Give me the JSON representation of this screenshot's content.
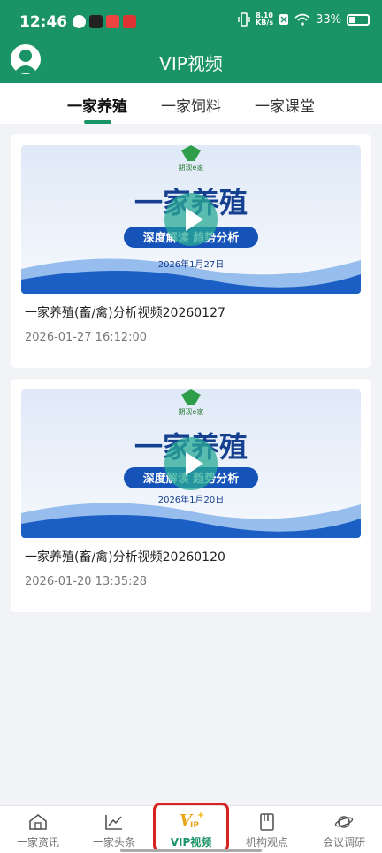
{
  "status_bar": {
    "time": "12:46",
    "speed_top": "8.10",
    "speed_unit": "KB/s",
    "battery": "33%"
  },
  "header": {
    "title": "VIP视频"
  },
  "tabs": [
    {
      "label": "一家养殖",
      "active": true
    },
    {
      "label": "一家饲料",
      "active": false
    },
    {
      "label": "一家课堂",
      "active": false
    }
  ],
  "videos": [
    {
      "title": "一家养殖(畜/禽)分析视频20260127",
      "time": "2026-01-27 16:12:00",
      "thumb": {
        "logo": "期现e家",
        "headline": "一家养殖",
        "subtitle": "深度解读 趋势分析",
        "date": "2026年1月27日"
      }
    },
    {
      "title": "一家养殖(畜/禽)分析视频20260120",
      "time": "2026-01-20 13:35:28",
      "thumb": {
        "logo": "期现e家",
        "headline": "一家养殖",
        "subtitle": "深度解读 趋势分析",
        "date": "2026年1月20日"
      }
    }
  ],
  "bottom_nav": [
    {
      "label": "一家资讯",
      "icon": "home-icon"
    },
    {
      "label": "一家头条",
      "icon": "trend-chart-icon"
    },
    {
      "label": "VIP视频",
      "icon": "vip-icon",
      "active": true
    },
    {
      "label": "机构观点",
      "icon": "book-icon"
    },
    {
      "label": "会议调研",
      "icon": "planet-icon"
    }
  ],
  "colors": {
    "brand_green": "#1a9466",
    "highlight_red": "#d6231f",
    "thumb_blue": "#1553b8"
  }
}
